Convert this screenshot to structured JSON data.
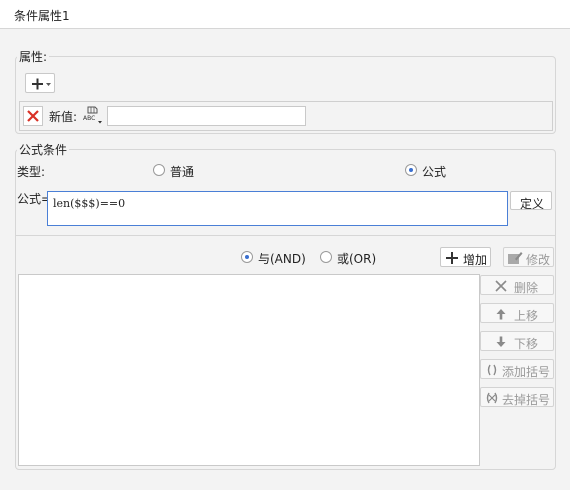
{
  "window": {
    "title": "条件属性1"
  },
  "attributes": {
    "group_label": "属性:",
    "add_icon": "plus-icon",
    "new_value_label": "新值:",
    "new_value_text": ""
  },
  "formula": {
    "group_label": "公式条件",
    "type_label": "类型:",
    "type_options": [
      {
        "label": "普通",
        "selected": false
      },
      {
        "label": "公式",
        "selected": true
      }
    ],
    "formula_label": "公式=",
    "formula_value": "len($$$)==0",
    "define_button": "定义"
  },
  "logic": {
    "and_label": "与(AND)",
    "or_label": "或(OR)",
    "selected": "and",
    "add_button": "增加",
    "edit_button": "修改",
    "delete_button": "删除",
    "move_up_button": "上移",
    "move_down_button": "下移",
    "add_bracket_button": "添加括号",
    "remove_bracket_button": "去掉括号"
  },
  "colors": {
    "accent": "#3a6fcf",
    "delete_red": "#d93025",
    "focus_border": "#4a7fd6"
  }
}
